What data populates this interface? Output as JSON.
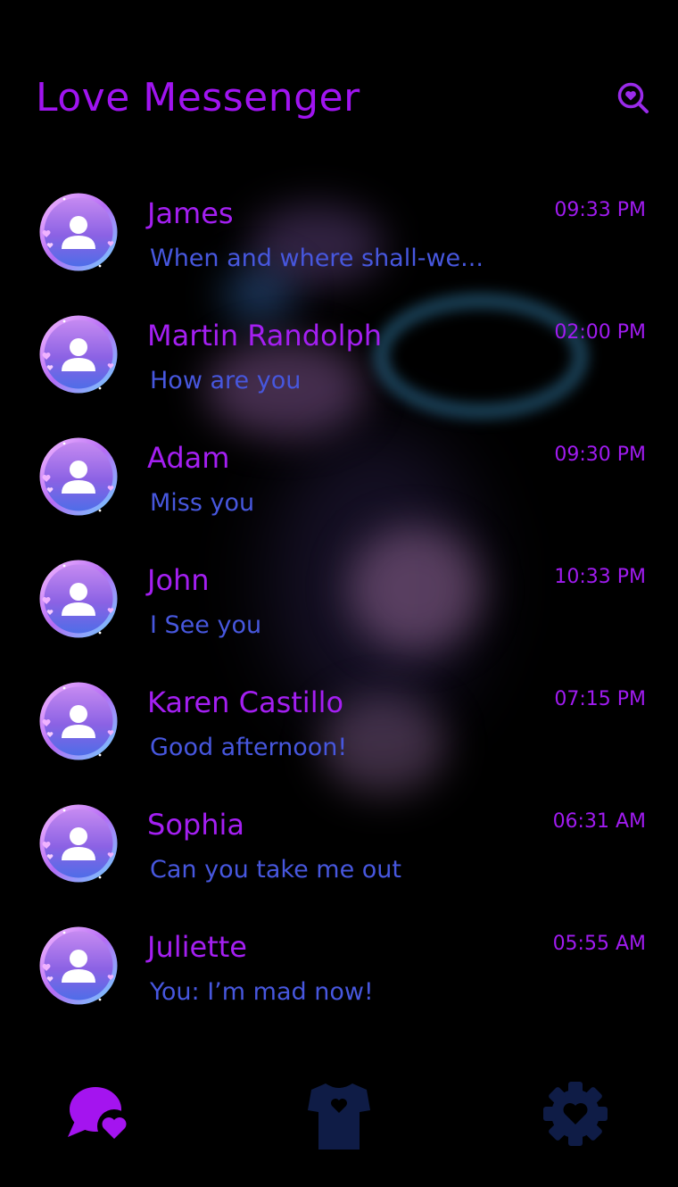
{
  "app": {
    "title": "Love Messenger"
  },
  "header": {
    "search_icon": "search-heart-icon"
  },
  "colors": {
    "title": "#a014f0",
    "name": "#a41ff2",
    "preview": "#4757de",
    "time": "#a01bf0",
    "nav_active": "#a414ef",
    "nav_inactive": "#0f1c46"
  },
  "conversations": [
    {
      "name": "James",
      "preview": "When and where shall-we...",
      "time": "09:33 PM"
    },
    {
      "name": "Martin Randolph",
      "preview": "How are you",
      "time": "02:00 PM"
    },
    {
      "name": "Adam",
      "preview": "Miss you",
      "time": "09:30 PM"
    },
    {
      "name": "John",
      "preview": "I See you",
      "time": "10:33 PM"
    },
    {
      "name": "Karen Castillo",
      "preview": "Good afternoon!",
      "time": "07:15 PM"
    },
    {
      "name": "Sophia",
      "preview": "Can you take me out",
      "time": "06:31 AM"
    },
    {
      "name": "Juliette",
      "preview": "You: I’m mad now!",
      "time": "05:55 AM"
    }
  ],
  "bottom_nav": {
    "items": [
      {
        "icon": "chat-heart-icon",
        "active": true
      },
      {
        "icon": "shirt-heart-icon",
        "active": false
      },
      {
        "icon": "gear-heart-icon",
        "active": false
      }
    ]
  }
}
